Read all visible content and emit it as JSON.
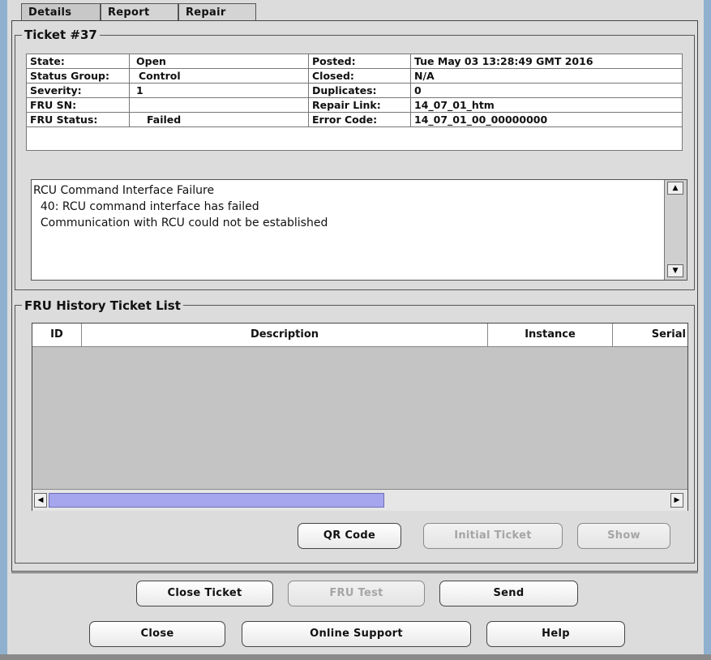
{
  "tabs": [
    {
      "label": "Details"
    },
    {
      "label": "Report"
    },
    {
      "label": "Repair"
    }
  ],
  "ticket": {
    "title": "Ticket #37",
    "fields": {
      "state_label": "State:",
      "state_value": "Open",
      "posted_label": "Posted:",
      "posted_value": "Tue May 03 13:28:49 GMT 2016",
      "status_group_label": "Status Group:",
      "status_group_value": "Control",
      "closed_label": "Closed:",
      "closed_value": "N/A",
      "severity_label": "Severity:",
      "severity_value": "1",
      "duplicates_label": "Duplicates:",
      "duplicates_value": "0",
      "fru_sn_label": "FRU SN:",
      "fru_sn_value": "",
      "repair_link_label": "Repair Link:",
      "repair_link_value": "14_07_01_htm",
      "fru_status_label": "FRU Status:",
      "fru_status_value": "Failed",
      "error_code_label": "Error Code:",
      "error_code_value": "14_07_01_00_00000000"
    },
    "description": [
      "RCU Command Interface Failure",
      "  40: RCU command interface has failed",
      "  Communication with RCU could not be established"
    ]
  },
  "fru_history": {
    "title": "FRU History Ticket List",
    "columns": [
      "ID",
      "Description",
      "Instance",
      "Serial"
    ],
    "rows": [],
    "buttons": {
      "qr_code": "QR Code",
      "initial_ticket": "Initial Ticket",
      "show": "Show"
    }
  },
  "footer": {
    "close_ticket": "Close Ticket",
    "fru_test": "FRU Test",
    "send": "Send",
    "close": "Close",
    "online_support": "Online Support",
    "help": "Help"
  },
  "icons": {
    "scroll_up": "up-arrow-icon",
    "scroll_down": "down-arrow-icon",
    "scroll_left": "left-arrow-icon",
    "scroll_right": "right-arrow-icon"
  },
  "colors": {
    "panel_bg": "#dcdcdc",
    "window_edge": "#8fb1cf",
    "scroll_thumb": "#a6a6ee",
    "table_empty": "#c4c4c4"
  }
}
